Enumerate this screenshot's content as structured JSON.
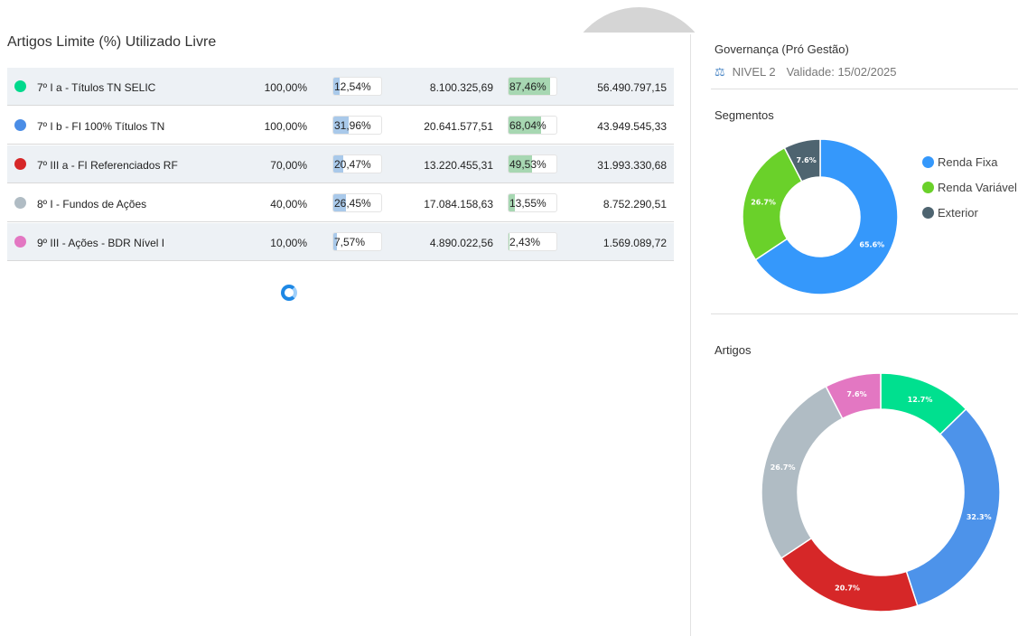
{
  "table": {
    "headers": {
      "artigos": "Artigos",
      "limite": "Limite (%)",
      "utilizado": "Utilizado",
      "livre": "Livre"
    },
    "rows": [
      {
        "color": "#00d98c",
        "name": "7º I a - Títulos TN SELIC",
        "limite": "100,00%",
        "utilizado_pct": "12,54%",
        "utilizado_frac": 0.1254,
        "utilizado_val": "8.100.325,69",
        "livre_pct": "87,46%",
        "livre_frac": 0.8746,
        "livre_val": "56.490.797,15"
      },
      {
        "color": "#4a8de6",
        "name": "7º I b - FI 100% Títulos TN",
        "limite": "100,00%",
        "utilizado_pct": "31,96%",
        "utilizado_frac": 0.3196,
        "utilizado_val": "20.641.577,51",
        "livre_pct": "68,04%",
        "livre_frac": 0.6804,
        "livre_val": "43.949.545,33"
      },
      {
        "color": "#d62728",
        "name": "7º III a - FI Referenciados RF",
        "limite": "70,00%",
        "utilizado_pct": "20,47%",
        "utilizado_frac": 0.2047,
        "utilizado_val": "13.220.455,31",
        "livre_pct": "49,53%",
        "livre_frac": 0.4953,
        "livre_val": "31.993.330,68"
      },
      {
        "color": "#b0bcc4",
        "name": "8º I - Fundos de Ações",
        "limite": "40,00%",
        "utilizado_pct": "26,45%",
        "utilizado_frac": 0.2645,
        "utilizado_val": "17.084.158,63",
        "livre_pct": "13,55%",
        "livre_frac": 0.1355,
        "livre_val": "8.752.290,51"
      },
      {
        "color": "#e377c2",
        "name": "9º III - Ações - BDR Nível I",
        "limite": "10,00%",
        "utilizado_pct": "7,57%",
        "utilizado_frac": 0.0757,
        "utilizado_val": "4.890.022,56",
        "livre_pct": "2,43%",
        "livre_frac": 0.0243,
        "livre_val": "1.569.089,72"
      }
    ]
  },
  "governance": {
    "title": "Governança (Pró Gestão)",
    "icon": "balance-scale-icon",
    "level": "NIVEL 2",
    "validity": "Validade: 15/02/2025"
  },
  "chart_data": [
    {
      "type": "pie",
      "title": "Segmentos",
      "categories": [
        "Renda Fixa",
        "Renda Variável",
        "Exterior"
      ],
      "values": [
        65.6,
        26.7,
        7.6
      ],
      "labels": [
        "65.6%",
        "26.7%",
        "7.6%"
      ],
      "colors": [
        "#3598fb",
        "#6ad12a",
        "#4e6470"
      ],
      "legend": "right"
    },
    {
      "type": "pie",
      "title": "Artigos",
      "categories": [
        "7º I a - Títulos TN SELIC",
        "7º I b - FI 100% Títulos TN",
        "7º III a - FI Referenciados RF",
        "8º I - Fundos de Ações",
        "9º III - Ações - BDR Nível I"
      ],
      "values": [
        12.7,
        32.3,
        20.7,
        26.7,
        7.6
      ],
      "labels": [
        "12.7%",
        "32.3%",
        "20.7%",
        "26.7%",
        "7.6%"
      ],
      "colors": [
        "#00e08f",
        "#4d93ea",
        "#d62728",
        "#b0bcc4",
        "#e377c2"
      ],
      "legend": "none"
    }
  ]
}
